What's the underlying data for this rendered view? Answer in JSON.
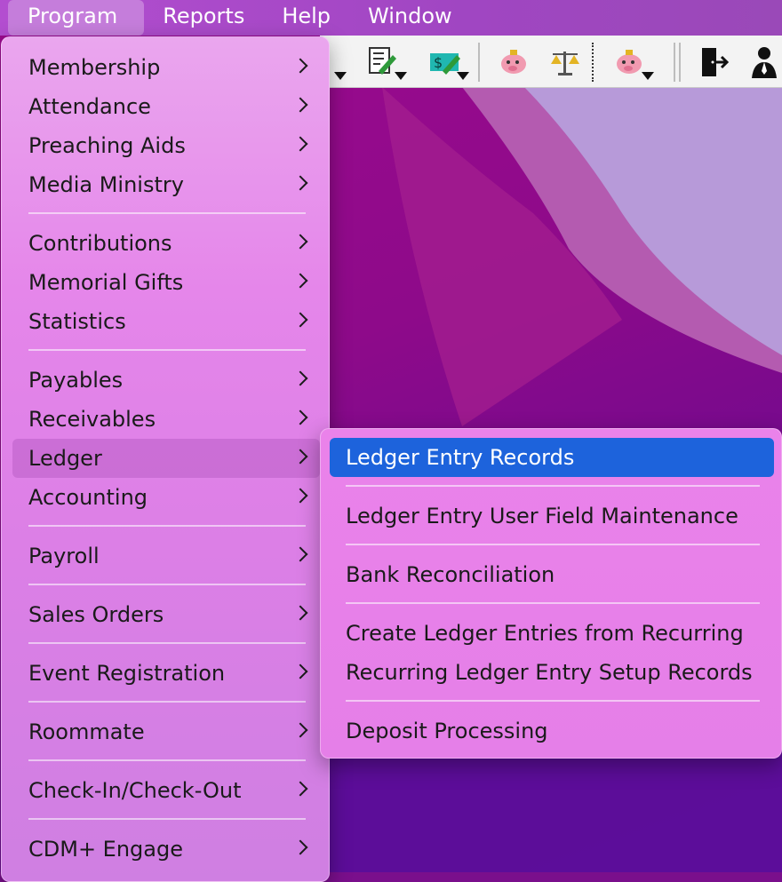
{
  "menubar": {
    "items": [
      {
        "label": "Program"
      },
      {
        "label": "Reports"
      },
      {
        "label": "Help"
      },
      {
        "label": "Window"
      }
    ]
  },
  "toolbar": {
    "icons": [
      "ledger-icon",
      "edit-document-icon",
      "money-edit-icon",
      "piggy-bank-icon",
      "balance-scale-icon",
      "piggy-bank-icon",
      "exit-door-icon",
      "user-icon"
    ]
  },
  "program_menu": {
    "items": [
      {
        "label": "Membership"
      },
      {
        "label": "Attendance"
      },
      {
        "label": "Preaching Aids"
      },
      {
        "label": "Media Ministry"
      },
      {
        "label": "Contributions"
      },
      {
        "label": "Memorial Gifts"
      },
      {
        "label": "Statistics"
      },
      {
        "label": "Payables"
      },
      {
        "label": "Receivables"
      },
      {
        "label": "Ledger"
      },
      {
        "label": "Accounting"
      },
      {
        "label": "Payroll"
      },
      {
        "label": "Sales Orders"
      },
      {
        "label": "Event Registration"
      },
      {
        "label": "Roommate"
      },
      {
        "label": "Check-In/Check-Out"
      },
      {
        "label": "CDM+ Engage"
      }
    ]
  },
  "ledger_submenu": {
    "items": [
      {
        "label": "Ledger Entry Records"
      },
      {
        "label": "Ledger Entry User Field Maintenance"
      },
      {
        "label": "Bank Reconciliation"
      },
      {
        "label": "Create Ledger Entries from Recurring"
      },
      {
        "label": "Recurring Ledger Entry Setup Records"
      },
      {
        "label": "Deposit Processing"
      }
    ]
  },
  "colors": {
    "selection": "#1d63dc",
    "menu_background": "#e586ea",
    "menubar_background": "#a046c2"
  }
}
